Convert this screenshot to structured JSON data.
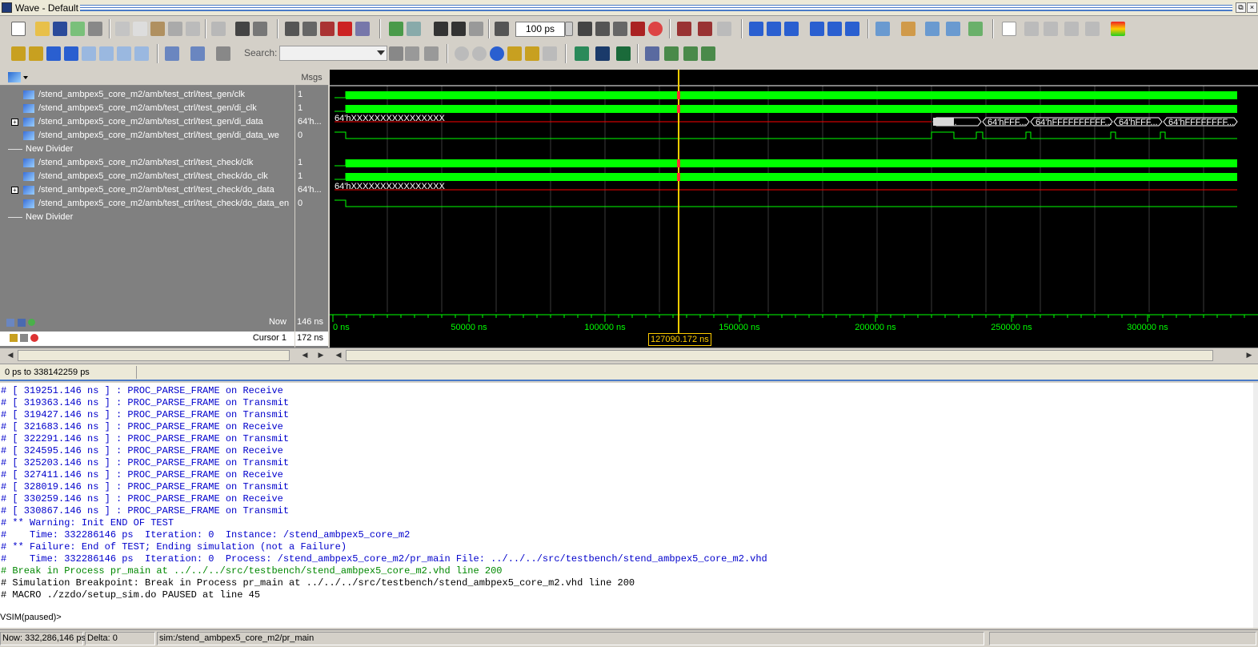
{
  "window": {
    "title": "Wave - Default"
  },
  "toolbar": {
    "zoom_value": "100",
    "zoom_unit": "ps",
    "search_label": "Search:",
    "search_value": ""
  },
  "signal_pane": {
    "header_msgs": "Msgs",
    "rows": [
      {
        "name": "/stend_ambpex5_core_m2/amb/test_ctrl/test_gen/clk",
        "value": "1",
        "expandable": false
      },
      {
        "name": "/stend_ambpex5_core_m2/amb/test_ctrl/test_gen/di_clk",
        "value": "1",
        "expandable": false
      },
      {
        "name": "/stend_ambpex5_core_m2/amb/test_ctrl/test_gen/di_data",
        "value": "64'h...",
        "expandable": true
      },
      {
        "name": "/stend_ambpex5_core_m2/amb/test_ctrl/test_gen/di_data_we",
        "value": "0",
        "expandable": false
      },
      {
        "name": "New Divider",
        "value": "",
        "divider": true
      },
      {
        "name": "/stend_ambpex5_core_m2/amb/test_ctrl/test_check/clk",
        "value": "1",
        "expandable": false
      },
      {
        "name": "/stend_ambpex5_core_m2/amb/test_ctrl/test_check/do_clk",
        "value": "1",
        "expandable": false
      },
      {
        "name": "/stend_ambpex5_core_m2/amb/test_ctrl/test_check/do_data",
        "value": "64'h...",
        "expandable": true
      },
      {
        "name": "/stend_ambpex5_core_m2/amb/test_ctrl/test_check/do_data_en",
        "value": "0",
        "expandable": false
      },
      {
        "name": "New Divider",
        "value": "",
        "divider": true
      }
    ]
  },
  "waves": {
    "bus_values": {
      "di_data_initial": "64'hXXXXXXXXXXXXXXXX",
      "di_data_1": "64'...",
      "di_data_2": "64'hFFF...",
      "di_data_3": "64'hFFFFFFFFFF...",
      "di_data_4": "64'hFFF...",
      "di_data_5": "64'hFFFFFFFF...",
      "do_data_initial": "64'hXXXXXXXXXXXXXXXX"
    },
    "colors": {
      "clock": "#00ff00",
      "cursor": "#ffcc00",
      "bus_x": "#ff0000",
      "bus_valid": "#00ff00"
    },
    "cursor_time_ns": 127090.172
  },
  "timebar": {
    "now_label": "Now",
    "now_value": "146 ns",
    "cursor_label": "Cursor 1",
    "cursor_value": "172 ns",
    "cursor_readout": "127090.172 ns",
    "ticks": [
      "0 ns",
      "50000 ns",
      "100000 ns",
      "150000 ns",
      "200000 ns",
      "250000 ns",
      "300000 ns"
    ]
  },
  "range_text": "0 ps to 338142259 ps",
  "transcript": [
    {
      "text": "# [ 319251.146 ns ] : PROC_PARSE_FRAME on Receive",
      "color": "#0000cc"
    },
    {
      "text": "# [ 319363.146 ns ] : PROC_PARSE_FRAME on Transmit",
      "color": "#0000cc"
    },
    {
      "text": "# [ 319427.146 ns ] : PROC_PARSE_FRAME on Transmit",
      "color": "#0000cc"
    },
    {
      "text": "# [ 321683.146 ns ] : PROC_PARSE_FRAME on Receive",
      "color": "#0000cc"
    },
    {
      "text": "# [ 322291.146 ns ] : PROC_PARSE_FRAME on Transmit",
      "color": "#0000cc"
    },
    {
      "text": "# [ 324595.146 ns ] : PROC_PARSE_FRAME on Receive",
      "color": "#0000cc"
    },
    {
      "text": "# [ 325203.146 ns ] : PROC_PARSE_FRAME on Transmit",
      "color": "#0000cc"
    },
    {
      "text": "# [ 327411.146 ns ] : PROC_PARSE_FRAME on Receive",
      "color": "#0000cc"
    },
    {
      "text": "# [ 328019.146 ns ] : PROC_PARSE_FRAME on Transmit",
      "color": "#0000cc"
    },
    {
      "text": "# [ 330259.146 ns ] : PROC_PARSE_FRAME on Receive",
      "color": "#0000cc"
    },
    {
      "text": "# [ 330867.146 ns ] : PROC_PARSE_FRAME on Transmit",
      "color": "#0000cc"
    },
    {
      "text": "# ** Warning: Init END OF TEST",
      "color": "#0000cc"
    },
    {
      "text": "#    Time: 332286146 ps  Iteration: 0  Instance: /stend_ambpex5_core_m2",
      "color": "#0000cc"
    },
    {
      "text": "# ** Failure: End of TEST; Ending simulation (not a Failure)",
      "color": "#0000cc"
    },
    {
      "text": "#    Time: 332286146 ps  Iteration: 0  Process: /stend_ambpex5_core_m2/pr_main File: ../../../src/testbench/stend_ambpex5_core_m2.vhd",
      "color": "#0000cc"
    },
    {
      "text": "# Break in Process pr_main at ../../../src/testbench/stend_ambpex5_core_m2.vhd line 200",
      "color": "#008800"
    },
    {
      "text": "# Simulation Breakpoint: Break in Process pr_main at ../../../src/testbench/stend_ambpex5_core_m2.vhd line 200",
      "color": "#000000"
    },
    {
      "text": "# MACRO ./zzdo/setup_sim.do PAUSED at line 45",
      "color": "#000000"
    }
  ],
  "prompt": "VSIM(paused)>",
  "statusbar": {
    "now": "Now: 332,286,146 ps",
    "delta": "Delta: 0",
    "context": "sim:/stend_ambpex5_core_m2/pr_main"
  }
}
